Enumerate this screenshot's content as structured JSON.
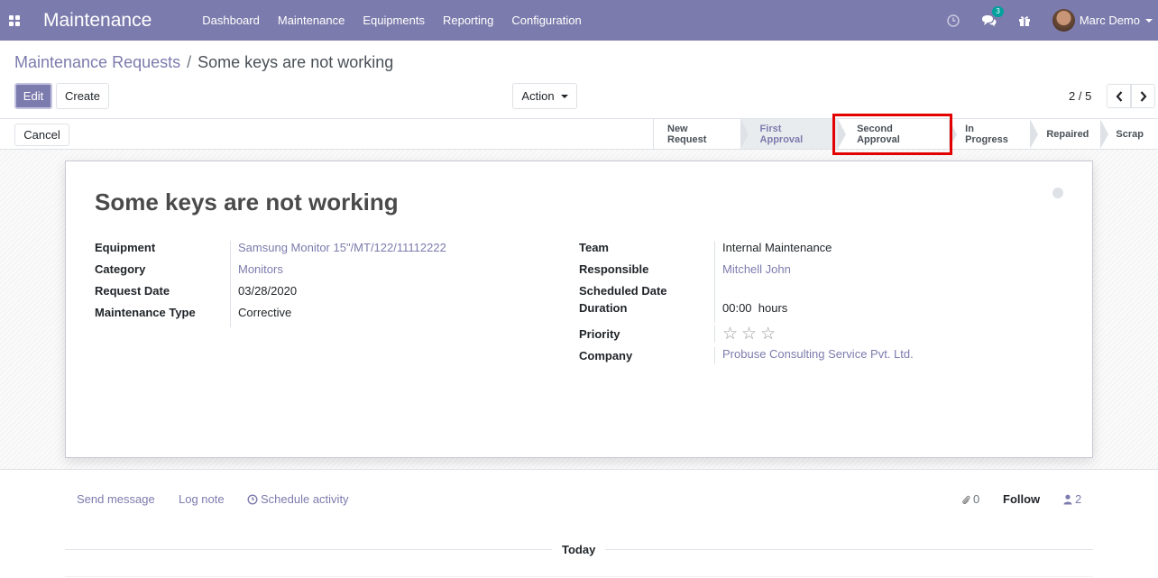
{
  "navbar": {
    "app_name": "Maintenance",
    "menu": [
      "Dashboard",
      "Maintenance",
      "Equipments",
      "Reporting",
      "Configuration"
    ],
    "messages_count": "3",
    "user_name": "Marc Demo",
    "background_color": "#7c7bad"
  },
  "breadcrumb": {
    "parent": "Maintenance Requests",
    "separator": "/",
    "current": "Some keys are not working"
  },
  "buttons": {
    "edit": "Edit",
    "create": "Create",
    "action": "Action",
    "cancel": "Cancel"
  },
  "pager": {
    "value": "2 / 5"
  },
  "stages": [
    {
      "label": "New Request",
      "current": false
    },
    {
      "label": "First Approval",
      "current": true
    },
    {
      "label": "Second Approval",
      "current": false,
      "highlighted": true
    },
    {
      "label": "In Progress",
      "current": false
    },
    {
      "label": "Repaired",
      "current": false
    },
    {
      "label": "Scrap",
      "current": false
    }
  ],
  "form": {
    "title": "Some keys are not working",
    "left": [
      {
        "label": "Equipment",
        "value": "Samsung Monitor 15\"/MT/122/11112222",
        "link": true
      },
      {
        "label": "Category",
        "value": "Monitors",
        "link": true
      },
      {
        "label": "Request Date",
        "value": "03/28/2020",
        "link": false
      },
      {
        "label": "Maintenance Type",
        "value": "Corrective",
        "link": false
      }
    ],
    "right": {
      "team_label": "Team",
      "team_value": "Internal Maintenance",
      "responsible_label": "Responsible",
      "responsible_value": "Mitchell John",
      "scheduled_label": "Scheduled Date",
      "scheduled_value": "",
      "duration_label": "Duration",
      "duration_value": "00:00",
      "duration_unit": "hours",
      "priority_label": "Priority",
      "priority_stars": 3,
      "priority_value": 0,
      "company_label": "Company",
      "company_value": "Probuse Consulting Service Pvt. Ltd."
    }
  },
  "chatter": {
    "send_message": "Send message",
    "log_note": "Log note",
    "schedule_activity": "Schedule activity",
    "attachments": "0",
    "follow": "Follow",
    "followers": "2",
    "today": "Today"
  },
  "icons": {
    "apps": "apps-grid-icon",
    "activity": "clock-icon",
    "messages": "chat-icon",
    "gift": "gift-icon",
    "prev": "chevron-left-icon",
    "next": "chevron-right-icon",
    "star": "star-outline-icon",
    "paperclip": "paperclip-icon",
    "user": "user-icon"
  }
}
